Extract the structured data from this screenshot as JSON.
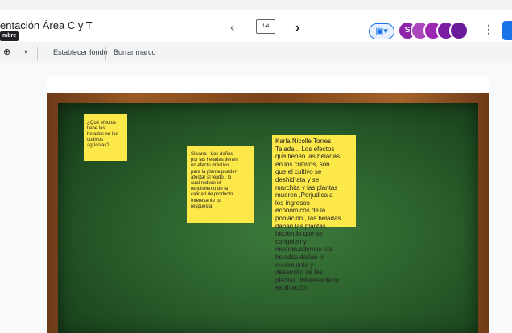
{
  "header": {
    "title": "entación Área C y T",
    "tooltip": "mbre",
    "slide_counter": "1/4",
    "present_icon": "▣▾",
    "more_icon": "⋮"
  },
  "nav": {
    "prev_icon": "‹",
    "next_icon": "›"
  },
  "collaborators": [
    {
      "initial": "S",
      "color": "#8e24aa"
    },
    {
      "initial": "",
      "color": "#ab47bc"
    },
    {
      "initial": "",
      "color": "#9c27b0"
    },
    {
      "initial": "",
      "color": "#7b1fa2"
    },
    {
      "initial": "",
      "color": "#6a1b9a"
    }
  ],
  "toolbar": {
    "zoom_icon": "⊕",
    "caret": "▾",
    "set_background": "Establecer fondo",
    "clear_frame": "Borrar marco"
  },
  "notes": [
    {
      "text": "¿Qué efectos\ntiene las\nheladas en los\ncultivos\nagrícolas?"
    },
    {
      "text": "Silvana : Los daños\npor las heladas tienen\nun efecto drástico\npara la planta pueden\nafectar al tejido , lo\ncual reduce el\nrendimiento de la\ncalidad de producto.\nInteresante tu\nrespuesta."
    },
    {
      "text": "Karla Nicolle Torres\nTejada  .. Los efectos\nque tienen las heladas\nen los cultivos, son\nque el cultivo se\ndeshidrata  y se\nmarchita y las plantas\nmueren ,Perjudica a\nlos ingresos\neconómicos  de la\npoblacion , las heladas\ndañan las   plantas\nhaciendo que se\ncongelen y\nmueran,ademas las\nheladas dañan el\ncrecimiento y\ndesarrollo de las\nplantas. Interesante tu\nexplicación."
    }
  ]
}
